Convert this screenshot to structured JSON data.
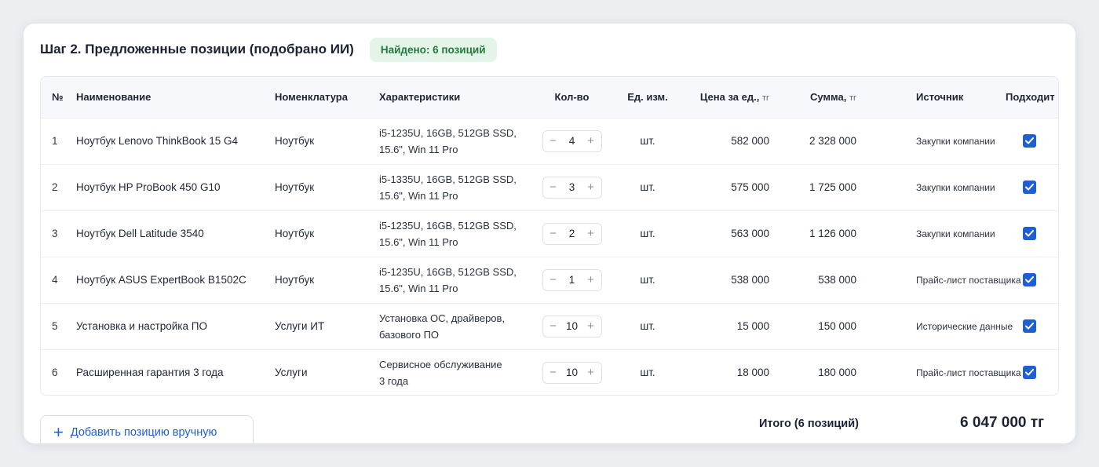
{
  "header": {
    "title": "Шаг 2. Предложенные позиции (подобрано ИИ)",
    "badge": "Найдено: 6 позиций"
  },
  "table": {
    "columns": {
      "no": "№",
      "name": "Наименование",
      "nomenclature": "Номенклатура",
      "specs": "Характеристики",
      "qty": "Кол-во",
      "unit": "Ед. изм.",
      "price": "Цена за ед.,",
      "price_unit": "тг",
      "sum": "Сумма,",
      "sum_unit": "тг",
      "source": "Источник",
      "fits": "Подходит"
    },
    "rows": [
      {
        "no": "1",
        "name": "Ноутбук Lenovo ThinkBook 15 G4",
        "nomenclature": "Ноутбук",
        "specs_1": "i5-1235U, 16GB, 512GB SSD,",
        "specs_2": "15.6\", Win 11 Pro",
        "qty": "4",
        "unit": "шт.",
        "price": "582 000",
        "sum": "2 328 000",
        "source": "Закупки компании",
        "fits": true
      },
      {
        "no": "2",
        "name": "Ноутбук HP ProBook 450 G10",
        "nomenclature": "Ноутбук",
        "specs_1": "i5-1335U, 16GB, 512GB SSD,",
        "specs_2": "15.6\", Win 11 Pro",
        "qty": "3",
        "unit": "шт.",
        "price": "575 000",
        "sum": "1 725 000",
        "source": "Закупки компании",
        "fits": true
      },
      {
        "no": "3",
        "name": "Ноутбук Dell Latitude 3540",
        "nomenclature": "Ноутбук",
        "specs_1": "i5-1235U, 16GB, 512GB SSD,",
        "specs_2": "15.6\", Win 11 Pro",
        "qty": "2",
        "unit": "шт.",
        "price": "563 000",
        "sum": "1 126 000",
        "source": "Закупки компании",
        "fits": true
      },
      {
        "no": "4",
        "name": "Ноутбук ASUS ExpertBook B1502C",
        "nomenclature": "Ноутбук",
        "specs_1": "i5-1235U, 16GB, 512GB SSD,",
        "specs_2": "15.6\", Win 11 Pro",
        "qty": "1",
        "unit": "шт.",
        "price": "538 000",
        "sum": "538 000",
        "source": "Прайс-лист поставщика",
        "fits": true
      },
      {
        "no": "5",
        "name": "Установка и настройка ПО",
        "nomenclature": "Услуги ИТ",
        "specs_1": "Установка ОС, драйверов,",
        "specs_2": "базового ПО",
        "qty": "10",
        "unit": "шт.",
        "price": "15 000",
        "sum": "150 000",
        "source": "Исторические данные",
        "fits": true
      },
      {
        "no": "6",
        "name": "Расширенная гарантия 3 года",
        "nomenclature": "Услуги",
        "specs_1": "Сервисное обслуживание",
        "specs_2": "3 года",
        "qty": "10",
        "unit": "шт.",
        "price": "18 000",
        "sum": "180 000",
        "source": "Прайс-лист поставщика",
        "fits": true
      }
    ],
    "stepper": {
      "minus": "−",
      "plus": "+"
    }
  },
  "footer": {
    "add_label": "Добавить позицию вручную",
    "add_icon": "plus-icon",
    "total_label": "Итого (6 позиций)",
    "total_value": "6 047 000 тг"
  },
  "colors": {
    "accent": "#1f5fd6",
    "badge_bg": "#e4f4e8",
    "badge_text": "#237a3c"
  }
}
